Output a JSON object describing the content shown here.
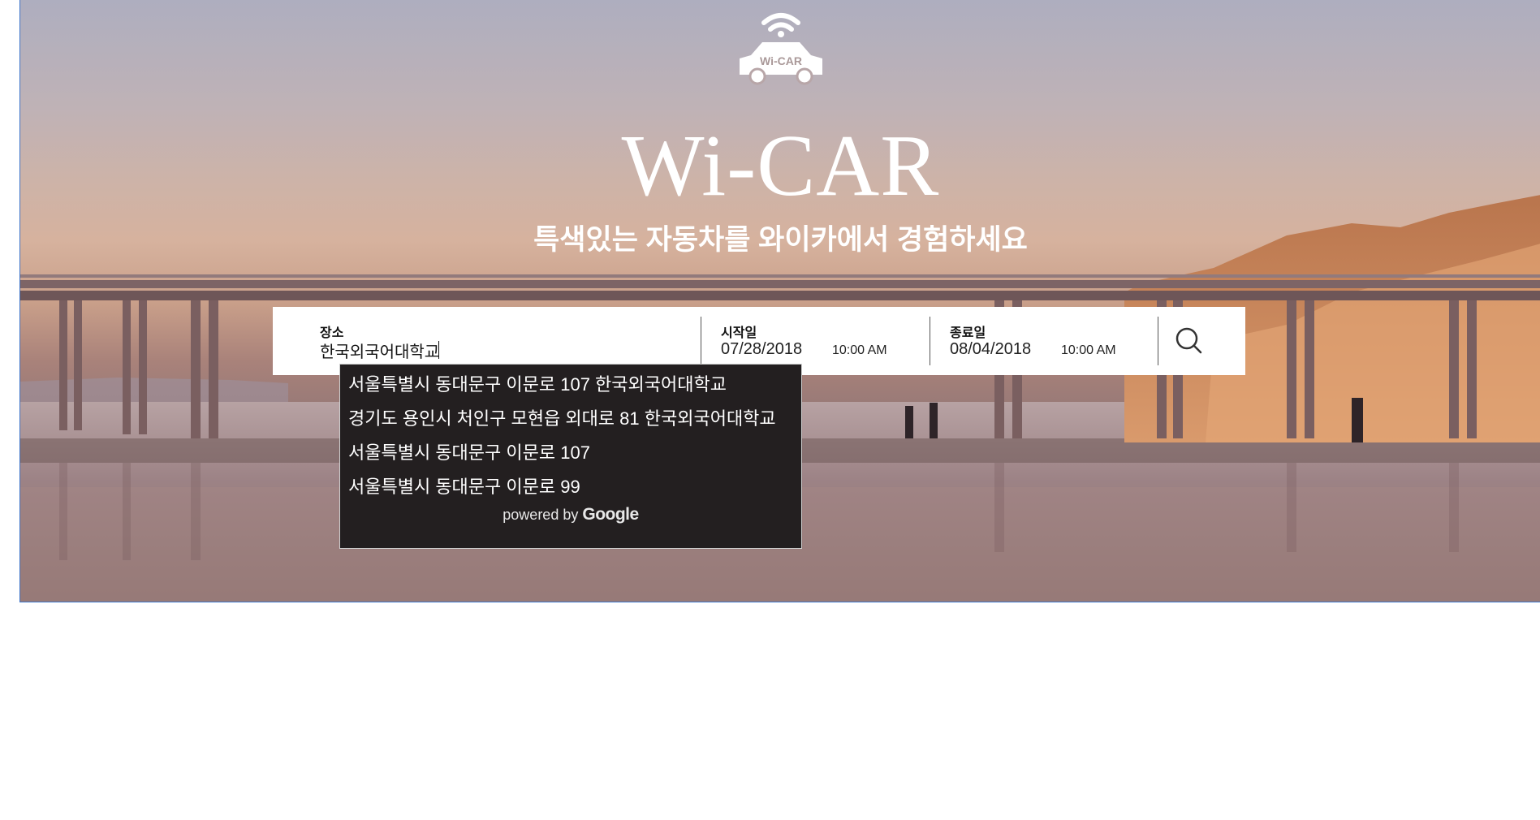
{
  "hero": {
    "logo_text": "Wi-CAR",
    "title": "Wi-CAR",
    "subtitle": "특색있는 자동차를 와이카에서 경험하세요"
  },
  "search": {
    "location_label": "장소",
    "location_value": "한국외국어대학교",
    "start_label": "시작일",
    "start_date": "07/28/2018",
    "start_time": "10:00 AM",
    "end_label": "종료일",
    "end_date": "08/04/2018",
    "end_time": "10:00 AM",
    "search_icon": "search-icon"
  },
  "autocomplete": {
    "suggestions": [
      "서울특별시 동대문구 이문로 107 한국외국어대학교",
      "경기도 용인시 처인구 모현읍 외대로 81 한국외국어대학교",
      "서울특별시 동대문구 이문로 107",
      "서울특별시 동대문구 이문로 99"
    ],
    "powered_prefix": "powered by",
    "powered_brand": "Google"
  },
  "colors": {
    "dropdown_bg": "#231f20",
    "hero_border": "#3b73c9"
  }
}
